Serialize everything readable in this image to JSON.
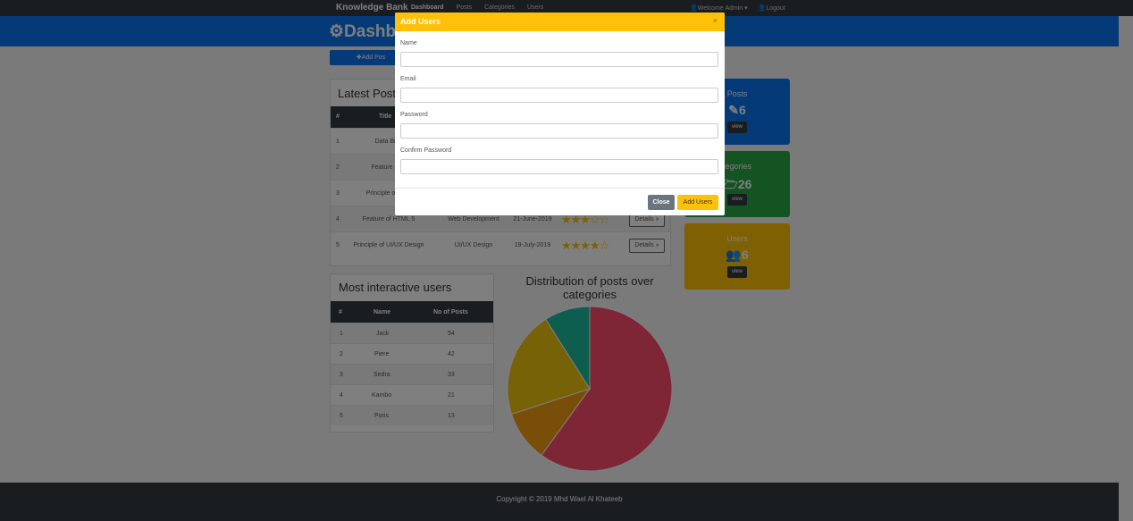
{
  "navbar": {
    "brand": "Knowledge Bank",
    "links": [
      "Dashboard",
      "Posts",
      "Categories",
      "Users"
    ],
    "welcome": "Welcome Admin",
    "welcome_caret": "▾",
    "logout": "Logout"
  },
  "header": {
    "title": "Dashbo"
  },
  "add_post_label": "Add Pos",
  "latest_posts": {
    "title": "Latest Post",
    "columns": [
      "#",
      "Title"
    ],
    "details_label": "Details »",
    "rows": [
      {
        "n": "1",
        "title": "Data Bind",
        "category": "",
        "date": "",
        "stars": ""
      },
      {
        "n": "2",
        "title": "Feature of H",
        "category": "",
        "date": "",
        "stars": ""
      },
      {
        "n": "3",
        "title": "Principle of UI/U",
        "category": "",
        "date": "",
        "stars": ""
      },
      {
        "n": "4",
        "title": "Feature of HTML 5",
        "category": "Web Development",
        "date": "21-June-2019",
        "stars": "★★★☆☆"
      },
      {
        "n": "5",
        "title": "Principle of UI/UX Design",
        "category": "UI/UX Design",
        "date": "19-July-2019",
        "stars": "★★★★☆"
      }
    ]
  },
  "interactive_users": {
    "title": "Most interactive users",
    "columns": [
      "#",
      "Name",
      "No of Posts"
    ],
    "rows": [
      {
        "n": "1",
        "name": "Jack",
        "posts": "54"
      },
      {
        "n": "2",
        "name": "Piere",
        "posts": "42"
      },
      {
        "n": "3",
        "name": "Sedra",
        "posts": "33"
      },
      {
        "n": "4",
        "name": "Kambo",
        "posts": "21"
      },
      {
        "n": "5",
        "name": "Poris",
        "posts": "13"
      }
    ]
  },
  "chart_data": {
    "type": "pie",
    "title": "Distribution of posts over categories",
    "values": [
      60,
      10,
      21,
      9
    ],
    "colors": [
      "#ff4d6d",
      "#f39c12",
      "#f1c40f",
      "#1abc9c"
    ]
  },
  "cards": [
    {
      "label": "Posts",
      "icon": "pencil-icon",
      "glyph": "✎",
      "value": "6",
      "button": "view",
      "color": "#0a74f0"
    },
    {
      "label": "tegories",
      "icon": "folder-icon",
      "glyph": "🗁",
      "value": "26",
      "button": "view",
      "color": "#28a745"
    },
    {
      "label": "Users",
      "icon": "users-icon",
      "glyph": "👥",
      "value": "6",
      "button": "view",
      "color": "#ffc107"
    }
  ],
  "footer": {
    "copyright": "Copyright © 2019 Mhd Wael Al Khateeb"
  },
  "modal": {
    "title": "Add Users",
    "close_glyph": "×",
    "fields": [
      {
        "label": "Name",
        "value": "",
        "placeholder": ""
      },
      {
        "label": "Email",
        "value": "",
        "placeholder": ""
      },
      {
        "label": "Password",
        "value": "",
        "placeholder": ""
      },
      {
        "label": "Confirm Password",
        "value": "",
        "placeholder": ""
      }
    ],
    "close_button": "Close",
    "submit_button": "Add Users"
  }
}
